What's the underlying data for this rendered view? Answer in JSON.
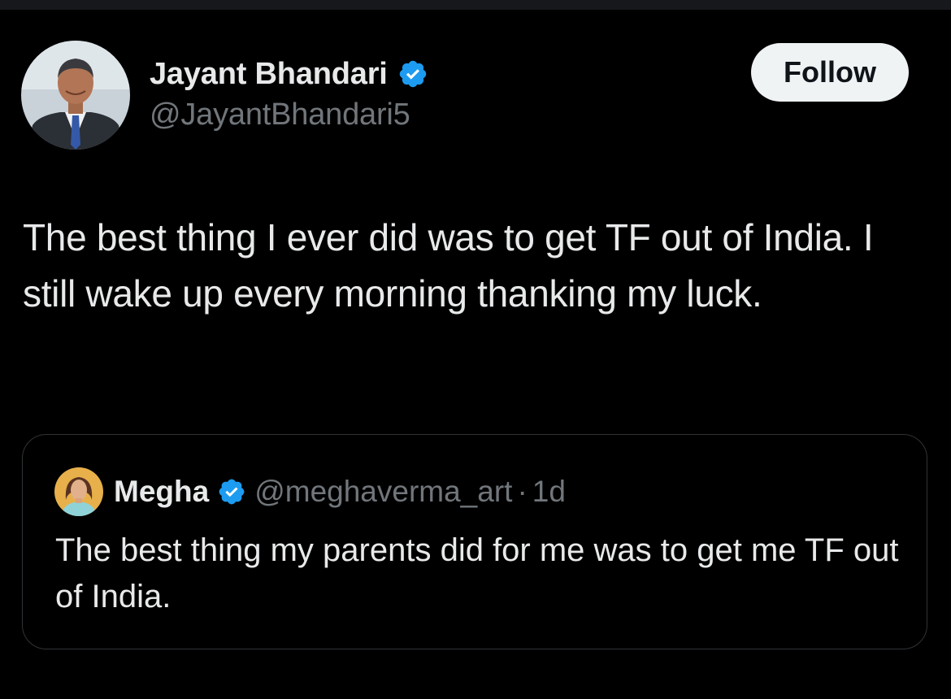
{
  "tweet": {
    "author": {
      "name": "Jayant Bhandari",
      "handle": "@JayantBhandari5",
      "verified": true,
      "avatar_icon": "profile-photo-man-in-suit"
    },
    "follow_label": "Follow",
    "text": "The best thing I ever did was to get TF out of India. I still wake up every morning thanking my luck.",
    "quoted": {
      "author": {
        "name": "Megha",
        "handle": "@meghaverma_art",
        "verified": true,
        "avatar_icon": "profile-photo-woman"
      },
      "separator": "·",
      "time": "1d",
      "text": "The best thing my parents did for me was to get me TF out of India."
    }
  },
  "colors": {
    "background": "#000000",
    "text_primary": "#e7e9ea",
    "text_secondary": "#71767b",
    "verified_blue": "#1d9bf0",
    "border": "#2f3336",
    "follow_bg": "#eff3f4",
    "follow_text": "#0f1419"
  }
}
